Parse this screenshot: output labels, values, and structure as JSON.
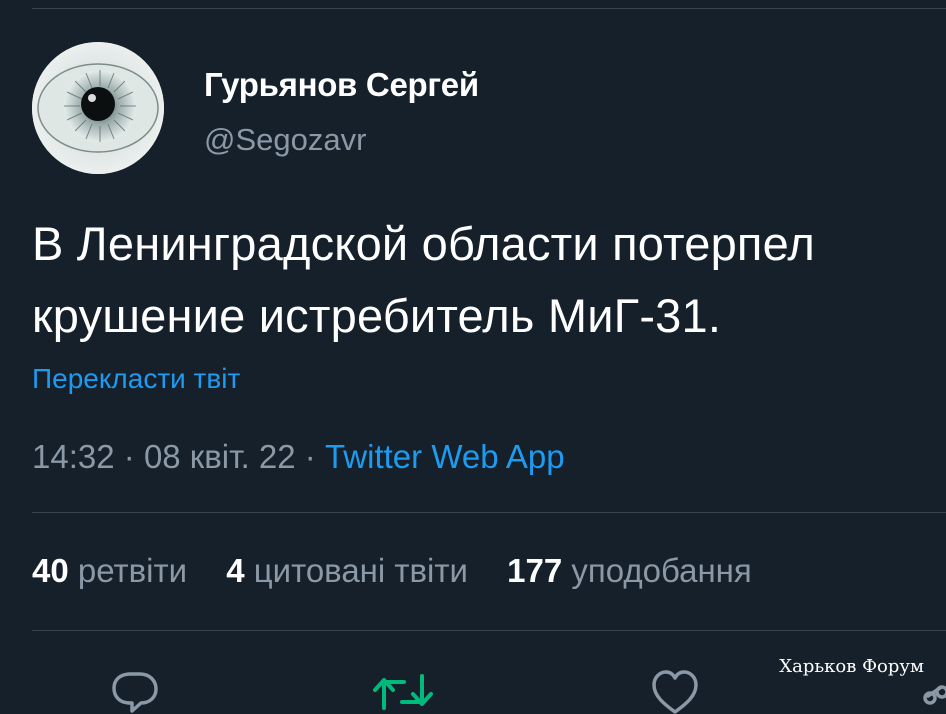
{
  "author": {
    "name": "Гурьянов Сергей",
    "handle": "@Segozavr",
    "avatar_icon": "eye-avatar"
  },
  "tweet": {
    "text_line1": "В Ленинградской области потерпел",
    "text_line2": "крушение истребитель МиГ-31.",
    "translate_link": "Перекласти твіт",
    "time": "14:32",
    "separator": "·",
    "date": "08 квіт. 22",
    "source": "Twitter Web App"
  },
  "stats": {
    "retweets_count": "40",
    "retweets_label": "ретвіти",
    "quotes_count": "4",
    "quotes_label": "цитовані твіти",
    "likes_count": "177",
    "likes_label": "уподобання"
  },
  "actions": {
    "reply_icon": "reply-icon",
    "retweet_icon": "retweet-icon",
    "like_icon": "heart-icon",
    "share_icon": "share-icon"
  },
  "watermark": "Харьков Форум",
  "colors": {
    "background": "#15202b",
    "text": "#ffffff",
    "secondary": "#8b98a5",
    "link": "#1d9bf0",
    "retweet_green": "#00ba7c",
    "divider": "#38444d"
  }
}
